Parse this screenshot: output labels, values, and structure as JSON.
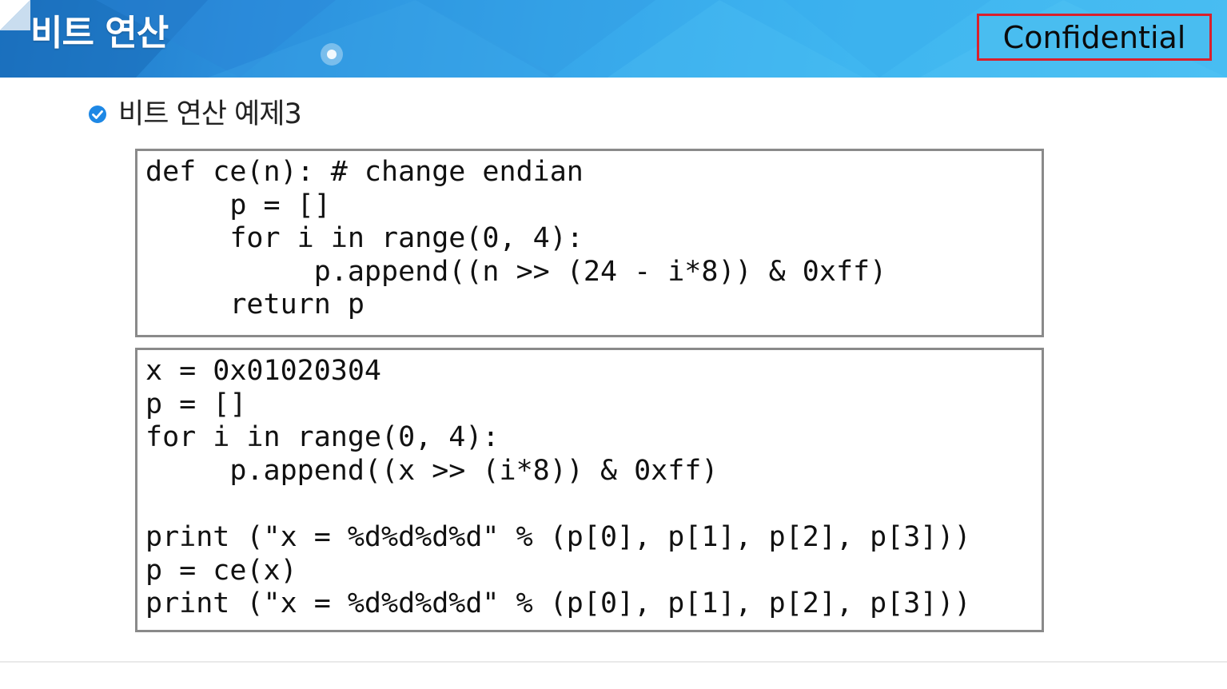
{
  "header": {
    "title": "비트 연산",
    "badge": "Confidential",
    "colors": {
      "band_start": "#1c75c4",
      "band_end": "#48bdf2",
      "badge_border": "#d9202c"
    }
  },
  "section": {
    "icon": "check-circle-icon",
    "icon_color": "#1e88e5",
    "title": "비트 연산 예제3"
  },
  "code_block_1": {
    "lines": [
      "def ce(n): # change endian",
      "     p = []",
      "     for i in range(0, 4):",
      "          p.append((n >> (24 - i*8)) & 0xff)",
      "     return p"
    ]
  },
  "code_block_2": {
    "lines": [
      "x = 0x01020304",
      "p = []",
      "for i in range(0, 4):",
      "     p.append((x >> (i*8)) & 0xff)",
      "",
      "print (\"x = %d%d%d%d\" % (p[0], p[1], p[2], p[3]))",
      "p = ce(x)",
      "print (\"x = %d%d%d%d\" % (p[0], p[1], p[2], p[3]))"
    ]
  }
}
